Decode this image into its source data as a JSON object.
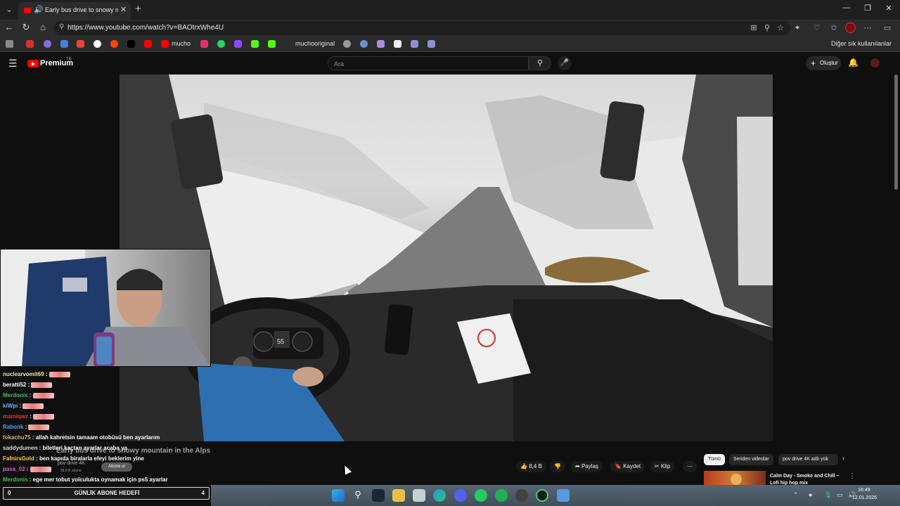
{
  "browser": {
    "tab_title": "Early bus drive to snowy mou",
    "url": "https://www.youtube.com/watch?v=BAOtrxWhe4U",
    "bookmarks": [
      {
        "label": "",
        "color": "#d93025"
      },
      {
        "label": "",
        "color": "#8a6bd8"
      },
      {
        "label": "",
        "color": "#4a7be0"
      },
      {
        "label": "",
        "color": "#ea4335"
      },
      {
        "label": "",
        "color": "#ffffff"
      },
      {
        "label": "",
        "color": "#ff4500"
      },
      {
        "label": "",
        "color": "#000000"
      },
      {
        "label": "",
        "color": "#ff0000"
      },
      {
        "label": "mucho",
        "color": "#ff0000"
      },
      {
        "label": "",
        "color": "#e1306c"
      },
      {
        "label": "",
        "color": "#25d366"
      },
      {
        "label": "",
        "color": "#9146ff"
      },
      {
        "label": "",
        "color": "#53fc18"
      },
      {
        "label": "muchooriginal",
        "color": "#53fc18"
      }
    ],
    "other_bookmarks": "Diğer sık kullanılanlar"
  },
  "youtube": {
    "brand": "Premium",
    "country": "TR",
    "search_placeholder": "Ara",
    "create_label": "Oluştur"
  },
  "video": {
    "dash_speed": "55"
  },
  "chat": [
    {
      "user": "nuclearvomit69",
      "color": "#f0e6a0",
      "msg": "",
      "emote": true
    },
    {
      "user": "beratti52",
      "color": "#ffffff",
      "msg": "",
      "emote": true
    },
    {
      "user": "Merdonis",
      "color": "#34c759",
      "msg": "",
      "emote": true
    },
    {
      "user": "kiWpi",
      "color": "#66b3ff",
      "msg": "",
      "emote": true
    },
    {
      "user": "mamiqwz",
      "color": "#e0393e",
      "msg": "",
      "emote": true
    },
    {
      "user": "Rabonk",
      "color": "#4aa3ff",
      "msg": "",
      "emote": true
    },
    {
      "user": "fokachu75",
      "color": "#d7b36a",
      "msg": "allah kahretsin tamaam otobüsü ben ayarlarım",
      "emote": false
    },
    {
      "user": "saddydumen",
      "color": "#d7d7d7",
      "msg": "biletleri kaçtan ayarlar acaba ya",
      "emote": false
    },
    {
      "user": "FafnirsGold",
      "color": "#ffd24a",
      "msg": "ben kapıda biralarla efeyi beklerim yine",
      "emote": false
    },
    {
      "user": "pasa_02",
      "color": "#e05cd6",
      "msg": "",
      "emote": true
    },
    {
      "user": "Merdonis",
      "color": "#34c759",
      "msg": "ege mer tobut yolculukta oynamak için ps5 ayarlar",
      "emote": false
    }
  ],
  "overlay": {
    "title": "Early bus drive to snowy mountain in the Alps",
    "channel": "pov drive 4K",
    "subs": "58,9 B abone",
    "subscribe": "Abone ol"
  },
  "actions": {
    "likes": "8,4 B",
    "share": "Paylaş",
    "save": "Kaydet",
    "clip": "Klip"
  },
  "chips": [
    {
      "label": "Tümü",
      "active": true
    },
    {
      "label": "Seriden videolar",
      "active": false
    },
    {
      "label": "pov drive 4K adlı yük",
      "active": false
    }
  ],
  "recommendation": {
    "title": "Calm Day - Smoke and Chill ~ Lofi hip hop mix"
  },
  "goal": {
    "left": "0",
    "label": "GÜNLİK ABONE HEDEFİ",
    "right": "4"
  },
  "clock": {
    "time": "16:49",
    "date": "12.01.2026"
  },
  "colors": {
    "youtube_red": "#ff0000",
    "page_bg": "#0f0f0f"
  }
}
